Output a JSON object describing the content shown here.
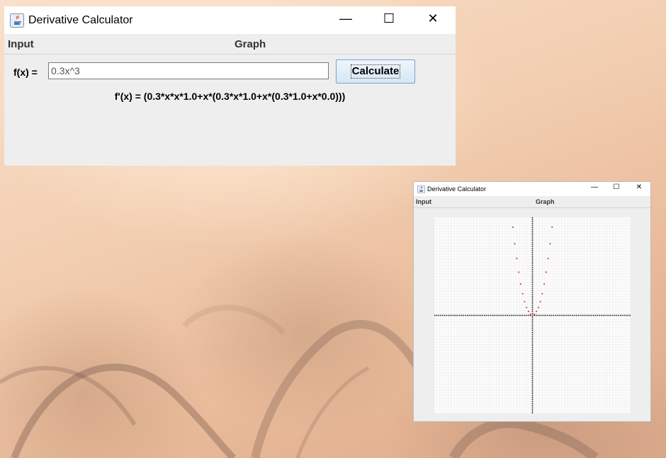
{
  "main_window": {
    "title": "Derivative Calculator",
    "icon": "java-cup-icon",
    "controls": {
      "minimize": "—",
      "maximize": "☐",
      "close": "✕"
    },
    "tabs": [
      "Input",
      "Graph"
    ],
    "input": {
      "label": "f(x) =",
      "value": "0.3x^3"
    },
    "calculate_label": "Calculate",
    "result": "f'(x) = (0.3*x*x*1.0+x*(0.3*x*1.0+x*(0.3*1.0+x*0.0)))"
  },
  "graph_window": {
    "title": "Derivative Calculator",
    "icon": "java-cup-icon",
    "controls": {
      "minimize": "—",
      "maximize": "☐",
      "close": "✕"
    },
    "tabs": [
      "Input",
      "Graph"
    ]
  },
  "chart_data": {
    "type": "scatter",
    "title": "",
    "xlabel": "",
    "ylabel": "",
    "xlim": [
      -10,
      10
    ],
    "ylim": [
      -10,
      10
    ],
    "grid": true,
    "series": [
      {
        "color": "#e02020",
        "x": [
          -2,
          -1.8,
          -1.6,
          -1.4,
          -1.2,
          -1.0,
          -0.8,
          -0.6,
          -0.4,
          -0.2,
          0,
          0.2,
          0.4,
          0.6,
          0.8,
          1.0,
          1.2,
          1.4,
          1.6,
          1.8,
          2
        ],
        "y": [
          9.0,
          7.3,
          5.8,
          4.4,
          3.2,
          2.2,
          1.4,
          0.8,
          0.4,
          0.1,
          0,
          0.1,
          0.4,
          0.8,
          1.4,
          2.2,
          3.2,
          4.4,
          5.8,
          7.3,
          9.0
        ]
      }
    ]
  }
}
